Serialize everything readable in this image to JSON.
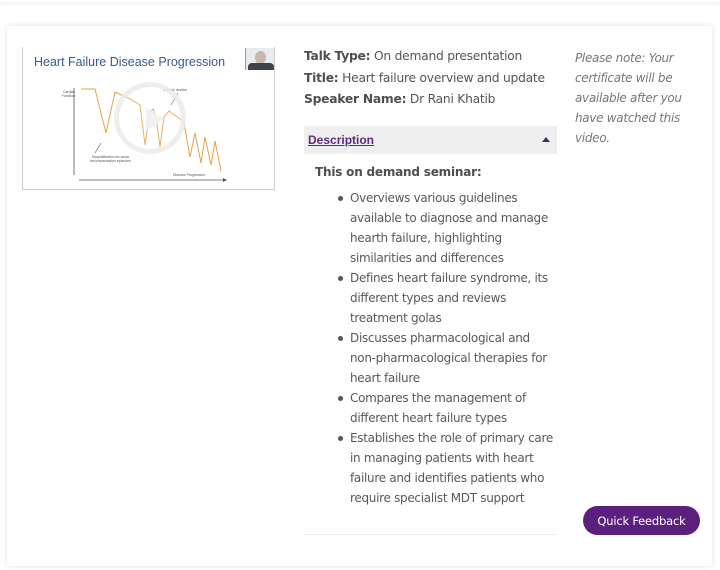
{
  "video": {
    "slide_title": "Heart Failure Disease Progression",
    "slide_labels": {
      "y_axis": "Cardiac Function",
      "x_axis": "Disease Progression",
      "annotation_top": "Chronic decline",
      "annotation_bottom": "Hospitalisation for acute decompensation episodes"
    },
    "play_icon": "play-circle-icon",
    "line_color": "#e8a24a"
  },
  "info": {
    "talk_type_label": "Talk Type:",
    "talk_type_value": "On demand presentation",
    "title_label": "Title:",
    "title_value": "Heart failure overview and update",
    "speaker_label": "Speaker Name:",
    "speaker_value": "Dr Rani Khatib"
  },
  "description": {
    "header_label": "Description",
    "expanded": true,
    "intro": "This on demand seminar:",
    "items": [
      "Overviews various guidelines available to diagnose and manage hearth failure, highlighting similarities and differences",
      "Defines heart failure syndrome, its different types and reviews treatment golas",
      "Discusses pharmacological and non-pharmacological therapies for heart failure",
      "Compares the management of different heart failure types",
      "Establishes the role of primary care in managing patients with heart failure and identifies patients who require specialist MDT support"
    ]
  },
  "note": "Please note: Your certificate will be available after you have watched this video.",
  "feedback_button": "Quick Feedback",
  "colors": {
    "accent": "#5b1f7e",
    "link": "#5c2a7e",
    "header_bg": "#efefef"
  }
}
